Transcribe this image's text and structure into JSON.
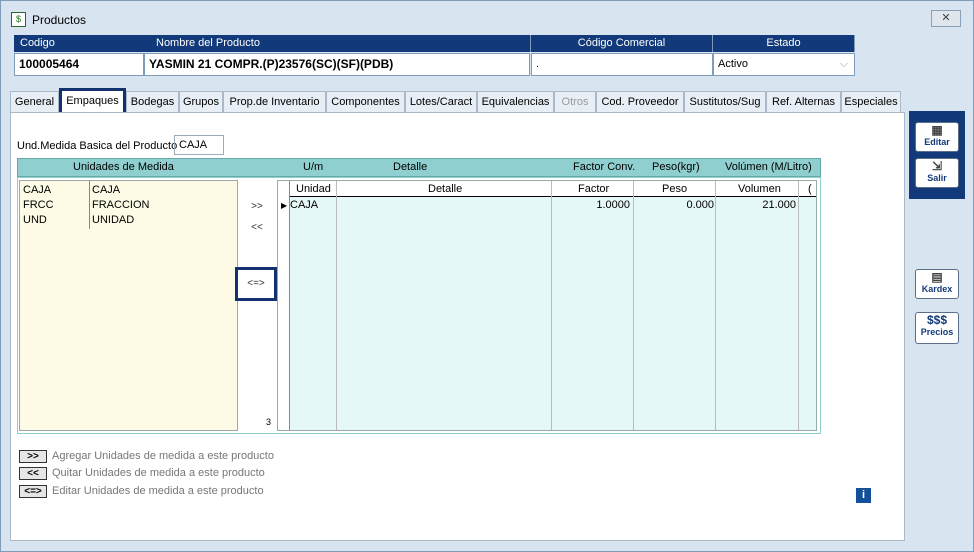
{
  "window": {
    "title": "Productos",
    "close": "✕"
  },
  "header": {
    "codigo_label": "Codigo",
    "nombre_label": "Nombre del Producto",
    "comercial_label": "Código Comercial",
    "estado_label": "Estado",
    "codigo": "100005464",
    "nombre": "YASMIN 21 COMPR.(P)23576(SC)(SF)(PDB)",
    "comercial": ".",
    "estado": "Activo"
  },
  "tabs": [
    "General",
    "Empaques",
    "Bodegas",
    "Grupos",
    "Prop.de Inventario",
    "Componentes",
    "Lotes/Caract",
    "Equivalencias",
    "Otros",
    "Cod. Proveedor",
    "Sustitutos/Sug",
    "Ref. Alternas",
    "Especiales"
  ],
  "form": {
    "und_label": "Und.Medida  Basica del Producto",
    "und_value": "CAJA"
  },
  "grid_header": {
    "unidades": "Unidades  de  Medida",
    "um": "U/m",
    "detalle": "Detalle",
    "factor": "Factor Conv.",
    "peso": "Peso(kgr)",
    "volumen": "Volúmen (M/Litro)"
  },
  "units": [
    {
      "code": "CAJA",
      "name": "CAJA"
    },
    {
      "code": "FRCC",
      "name": "FRACCION"
    },
    {
      "code": "UND",
      "name": "UNIDAD"
    }
  ],
  "buttons": {
    "add": ">>",
    "remove": "<<",
    "edit": "<=>"
  },
  "table": {
    "cols": [
      "Unidad",
      "Detalle",
      "Factor",
      "Peso",
      "Volumen",
      "("
    ],
    "rows": [
      {
        "unidad": "CAJA",
        "detalle": "",
        "factor": "1.0000",
        "peso": "0.000",
        "volumen": "21.000"
      }
    ],
    "row_count": "3"
  },
  "legend": [
    {
      "key": ">>",
      "text": "Agregar Unidades de medida a este producto"
    },
    {
      "key": "<<",
      "text": "Quitar Unidades de medida a este producto"
    },
    {
      "key": "<=>",
      "text": "Editar  Unidades de medida a este producto"
    }
  ],
  "sidebar": {
    "editar": "Editar",
    "salir": "Salir",
    "kardex": "Kardex",
    "precios_sym": "$$$",
    "precios": "Precios"
  },
  "info": "i"
}
